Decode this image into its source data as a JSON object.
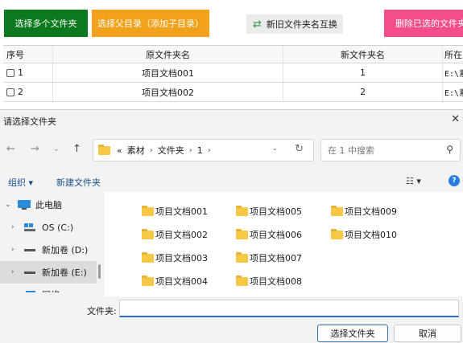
{
  "app": {
    "buttons": {
      "select_multiple": "选择多个文件夹",
      "select_parent": "选择父目录（添加子目录）",
      "swap_names": "新旧文件夹名互换",
      "delete_selected": "删除已选的文件夹"
    },
    "table": {
      "headers": [
        "序号",
        "原文件夹名",
        "新文件夹名",
        "所在目"
      ],
      "rows": [
        {
          "index": "1",
          "old_name": "项目文档001",
          "new_name": "1",
          "location": "E:\\素"
        },
        {
          "index": "2",
          "old_name": "项目文档002",
          "new_name": "2",
          "location": "E:\\素"
        }
      ]
    },
    "colors": {
      "green": "#0b7a1e",
      "orange": "#f2a21a",
      "pink": "#f34d8b"
    }
  },
  "dialog": {
    "title": "请选择文件夹",
    "close_icon": "close-icon",
    "path": {
      "overflow": "«",
      "segments": [
        "素材",
        "文件夹",
        "1"
      ]
    },
    "search_placeholder": "在 1 中搜索",
    "commands": {
      "organize": "组织 ▾",
      "new_folder": "新建文件夹",
      "view": "☷ ▾",
      "help": "?"
    },
    "nav": [
      {
        "label": "此电脑",
        "icon": "computer-icon",
        "expander": "⌄"
      },
      {
        "label": "OS (C:)",
        "icon": "windows-drive-icon",
        "expander": "›"
      },
      {
        "label": "新加卷 (D:)",
        "icon": "drive-icon",
        "expander": "›"
      },
      {
        "label": "新加卷 (E:)",
        "icon": "drive-icon",
        "expander": "›",
        "selected": true
      },
      {
        "label": "网络",
        "icon": "network-icon",
        "expander": "›"
      }
    ],
    "folders": [
      "项目文档001",
      "项目文档002",
      "项目文档003",
      "项目文档004",
      "项目文档005",
      "项目文档006",
      "项目文档007",
      "项目文档008",
      "项目文档009",
      "项目文档010"
    ],
    "footer": {
      "folder_label": "文件夹:",
      "folder_value": "",
      "select_button": "选择文件夹",
      "cancel_button": "取消"
    }
  }
}
